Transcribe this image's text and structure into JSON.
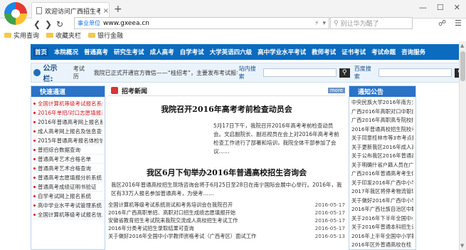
{
  "browser": {
    "tab_title": "欢迎访问广西招生考试",
    "tab_close": "×",
    "new_tab": "+",
    "win_min": "—",
    "win_max": "☐",
    "win_close": "✕",
    "secure_label": "事业单位",
    "url": "www.gxeea.cn",
    "search_placeholder": "别让华为酷了",
    "bookmarks": [
      "实用查询",
      "收藏夹栏",
      "银行金融"
    ]
  },
  "site": {
    "menu": [
      "首页",
      "本院概况",
      "普通高考",
      "研究生考试",
      "成人高考",
      "自学考试",
      "大学英语四六级",
      "高中学业水平考试",
      "教师考试",
      "证书考试",
      "考试命题",
      "咨询服务"
    ],
    "notice_label": "公示栏:",
    "notice_date": "考试历",
    "notice_text": "我院已正式开通官方微信——“桂招考”，主要发布考试报名",
    "site_search_label": "站内搜索",
    "baidu_search_label": "百度搜索",
    "left_header": "快速通道",
    "left_items": [
      {
        "text": "全国计算机等级考试报名系统",
        "red": true
      },
      {
        "text": "2016年单招/对口志愿填报系统",
        "red": true
      },
      {
        "text": "2016年普通高考网上报名系统",
        "red": false
      },
      {
        "text": "成人高考网上报名及信息查询",
        "red": false
      },
      {
        "text": "2015年普通高考报名体检信息查询",
        "red": false
      },
      {
        "text": "普招综合数据查询",
        "red": false
      },
      {
        "text": "普通高考艺术合格名单",
        "red": false
      },
      {
        "text": "普通高考艺术合格查询",
        "red": false
      },
      {
        "text": "普通高考志愿填报分析系统",
        "red": false
      },
      {
        "text": "普通高考成绩证明书验证",
        "red": false
      },
      {
        "text": "自学考试网上报名系统",
        "red": false
      },
      {
        "text": "高中学业水平考试管理系统",
        "red": false
      },
      {
        "text": "全国计算机等级考试报名信息",
        "red": false
      }
    ],
    "center_header": "招考新闻",
    "more": "more",
    "news1_title": "我院召开2016年高考考前检查动员会",
    "news1_body": "5月17日下午，我院召开2016年高考考前检查动员会。文启副院长、副巡视员在会上对2016年高考考前检查工作进行了部署和培训，我院全体干部参加了会议……",
    "news2_title": "我区6月下旬举办2016年普通高校招生咨询会",
    "news2_body": "我区2016年普通高校招生现场咨询会将于6月25日至28日在南宁国际会展中心举行。2016年，我区有33万人报名参加普通高考，为使考……",
    "news_list": [
      {
        "title": "全国计算机等级考试系统测试和考务培训会在我院召开",
        "date": "2016-05-17"
      },
      {
        "title": "2016年广西高职单招、高职对口招生成绩志愿填报开始",
        "date": "2016-05-17"
      },
      {
        "title": "安徽省教育招生考试院来我院交流成人高校招生考试工作",
        "date": "2016-05-17"
      },
      {
        "title": "2016年分类考试招生录取结果可查询",
        "date": "2016-05-17"
      },
      {
        "title": "关于做好2016年全国中小学教师资格考试（广西考区）面试工作",
        "date": "2016-05-13"
      }
    ],
    "right_header": "通知公告",
    "right_items": [
      "中央民族大学2016年南方少数",
      "广西2016年高职对口中职自",
      "广西2016年高职高专院校招生",
      "2016年普通高校招生院校考试",
      "关于同意桂林市等3市考点报",
      "关于更新我区2016年成人高",
      "关于公布我区2016年普通高",
      "关于明确什省户籍人员在广西",
      "广西2016年普通高考考生体检",
      "关于印发2016年广西中小学",
      "2017年我区将停考物流管理",
      "关于做好2016年广西中小学",
      "2016年广西壮族自治区中职",
      "关于2016年下半年全国中小学",
      "关于2016年普通本科招生计",
      "2016年上半年全国中小学教",
      "2016年区外普通高校在桂"
    ]
  }
}
